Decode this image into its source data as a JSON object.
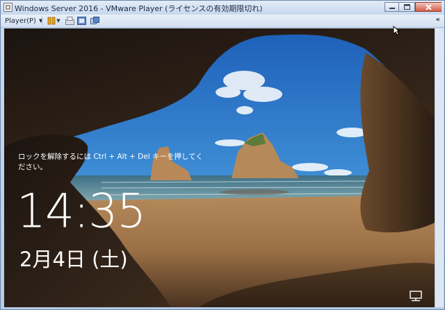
{
  "window": {
    "title": "Windows Server 2016 - VMware Player (ライセンスの有効期限切れ)"
  },
  "toolbar": {
    "player_menu": "Player(P)",
    "icons": [
      "pause-icon",
      "send-ctrl-alt-del-icon",
      "fullscreen-icon",
      "unity-icon"
    ]
  },
  "lockscreen": {
    "message": "ロックを解除するには Ctrl + Alt + Del キーを押してください。",
    "time": "14:35",
    "date": "2月4日 (土)"
  },
  "colors": {
    "titlebar": "#c6d8ef",
    "close_button": "#d35b45",
    "lock_text": "#ffffff"
  }
}
